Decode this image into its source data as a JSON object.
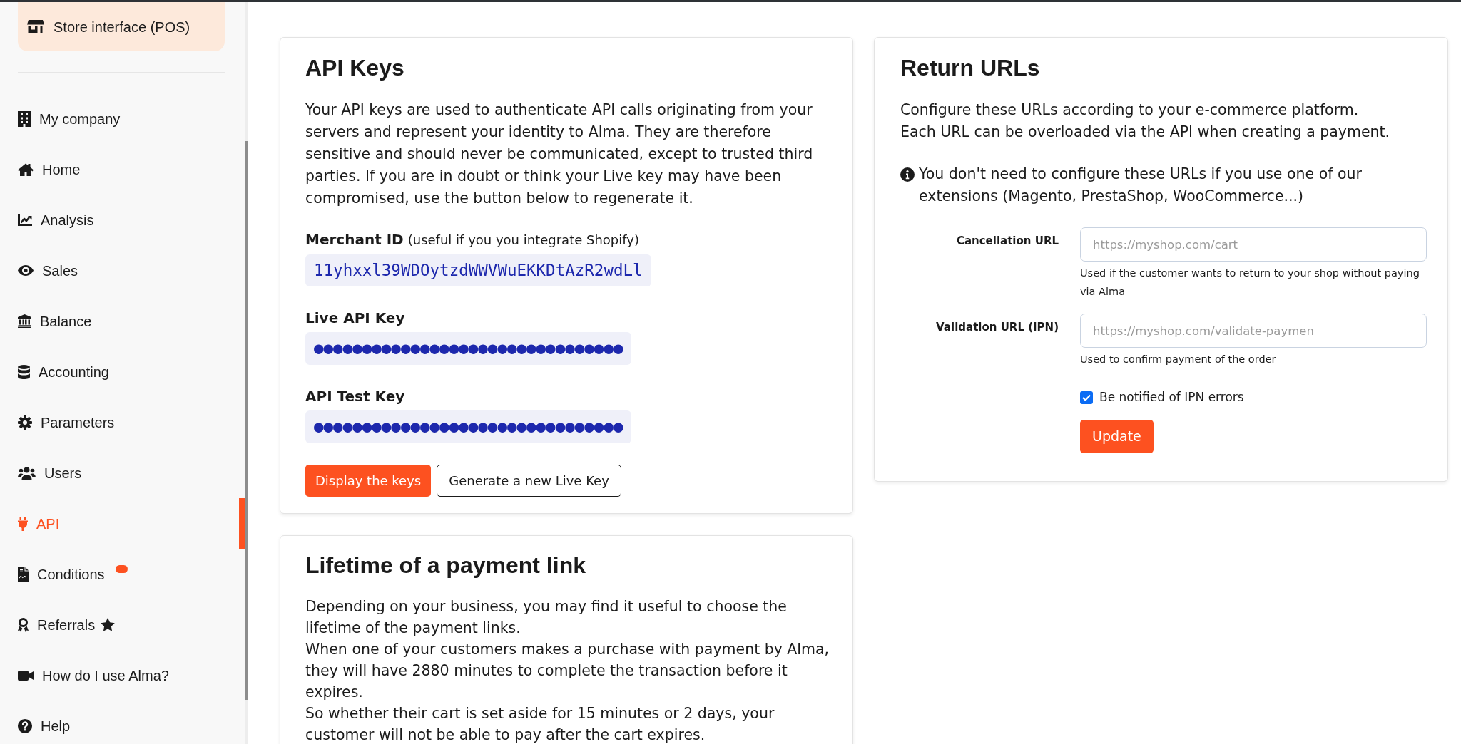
{
  "sidebar": {
    "store_button": {
      "label": "Store interface (POS)"
    },
    "items": [
      {
        "label": "My company",
        "selected": false,
        "notification": false
      },
      {
        "label": "Home",
        "selected": false,
        "notification": false
      },
      {
        "label": "Analysis",
        "selected": false,
        "notification": false
      },
      {
        "label": "Sales",
        "selected": false,
        "notification": false
      },
      {
        "label": "Balance",
        "selected": false,
        "notification": false
      },
      {
        "label": "Accounting",
        "selected": false,
        "notification": false
      },
      {
        "label": "Parameters",
        "selected": false,
        "notification": false
      },
      {
        "label": "Users",
        "selected": false,
        "notification": false
      },
      {
        "label": "API",
        "selected": true,
        "notification": false
      },
      {
        "label": "Conditions",
        "selected": false,
        "notification": true
      },
      {
        "label": "Referrals",
        "selected": false,
        "notification": false
      },
      {
        "label": "How do I use Alma?",
        "selected": false,
        "notification": false
      },
      {
        "label": "Help",
        "selected": false,
        "notification": false
      }
    ]
  },
  "api_keys": {
    "title": "API Keys",
    "description": "Your API keys are used to authenticate API calls originating from your servers and represent your identity to Alma. They are therefore sensitive and should never be communicated, except to trusted third parties. If you are in doubt or think your Live key may have been compromised, use the button below to regenerate it.",
    "merchant_id": {
      "label": "Merchant ID",
      "note": "(useful if you you integrate Shopify)",
      "value": "11yhxxl39WDOytzdWWVWuEKKDtAzR2wdLl"
    },
    "keys": [
      {
        "label": "Live API Key",
        "value": "●●●●●●●●●●●●●●●●●●●●●●●●●●●●●●●●"
      },
      {
        "label": "API Test Key",
        "value": "●●●●●●●●●●●●●●●●●●●●●●●●●●●●●●●●"
      }
    ],
    "buttons": [
      {
        "label": "Display the keys",
        "kind": "primary"
      },
      {
        "label": "Generate a new Live Key",
        "kind": "outline"
      }
    ]
  },
  "return_urls": {
    "title": "Return URLs",
    "intro_lines": [
      "Configure these URLs according to your e-commerce platform.",
      "Each URL can be overloaded via the API when creating a payment."
    ],
    "info": "You don't need to configure these URLs if you use one of our extensions (Magento, PrestaShop, WooCommerce...)",
    "fields": [
      {
        "label": "Cancellation URL",
        "placeholder": "https://myshop.com/cart",
        "help": "Used if the customer wants to return to your shop without paying via Alma"
      },
      {
        "label": "Validation URL (IPN)",
        "placeholder": "https://myshop.com/validate-paymen",
        "help": "Used to confirm payment of the order"
      }
    ],
    "checkbox": {
      "label": "Be notified of IPN errors",
      "checked": true
    },
    "button": {
      "label": "Update"
    }
  },
  "payment_link_lifetime": {
    "title": "Lifetime of a payment link",
    "paragraphs": [
      "Depending on your business, you may find it useful to choose the lifetime of the payment links.",
      "When one of your customers makes a purchase with payment by Alma, they will have 2880 minutes to complete the transaction before it expires.",
      "So whether their cart is set aside for 15 minutes or 2 days, your customer will not be able to pay after the cart expires."
    ]
  }
}
